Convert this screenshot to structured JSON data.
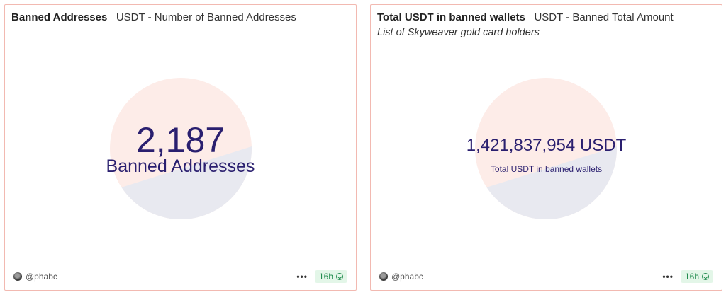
{
  "colors": {
    "card_border": "#f2b9b1",
    "circle_top": "#fdece8",
    "circle_bottom": "#e8e9f0",
    "number_text": "#2a1f6f",
    "badge_bg": "#e3f6e8",
    "badge_text": "#1f8a4c"
  },
  "cards": [
    {
      "title": "Banned Addresses",
      "source": "USDT",
      "separator": "-",
      "source_title": "Number of Banned Addresses",
      "value": "2,187",
      "label": "Banned Addresses",
      "author": "@phabc",
      "age_badge": "16h",
      "menu_icon": "more-dots-icon"
    },
    {
      "title": "Total USDT in banned wallets",
      "source": "USDT",
      "separator": "-",
      "source_title": "Banned Total Amount",
      "subtitle": "List of Skyweaver gold card holders",
      "value": "1,421,837,954 USDT",
      "label": "Total USDT in banned wallets",
      "author": "@phabc",
      "age_badge": "16h",
      "menu_icon": "more-dots-icon"
    }
  ]
}
